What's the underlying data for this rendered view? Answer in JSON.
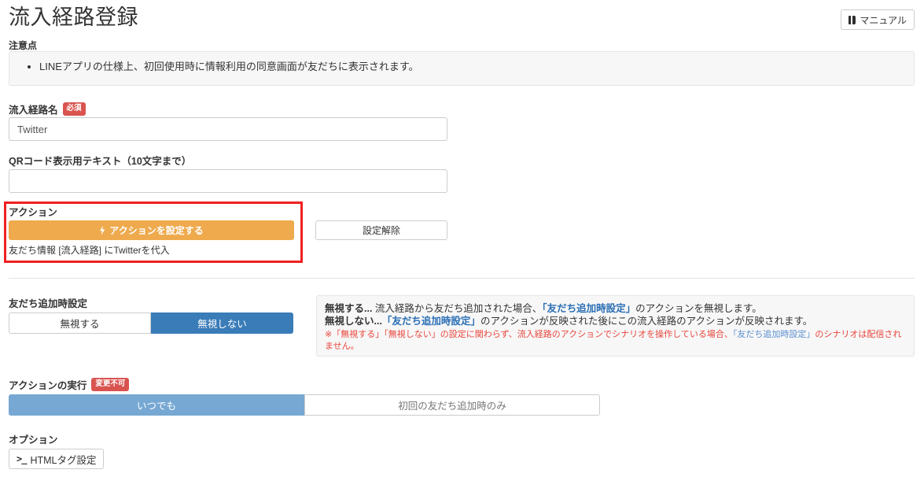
{
  "header": {
    "title": "流入経路登録",
    "manual_button": {
      "label": "マニュアル",
      "icon": "book-icon"
    }
  },
  "notice": {
    "label": "注意点",
    "items": [
      "LINEアプリの仕様上、初回使用時に情報利用の同意画面が友だちに表示されます。"
    ]
  },
  "fields": {
    "route_name": {
      "label": "流入経路名",
      "badge": "必須",
      "value": "Twitter",
      "placeholder": ""
    },
    "qr_text": {
      "label": "QRコード表示用テキスト（10文字まで）",
      "value": "",
      "placeholder": ""
    }
  },
  "action": {
    "label": "アクション",
    "set_button": {
      "label": "アクションを設定する",
      "icon": "bolt-icon",
      "color": "#eeaa4d"
    },
    "description": "友だち情報 [流入経路] にTwitterを代入",
    "clear_button": {
      "label": "設定解除"
    },
    "highlight_color": "#f02020"
  },
  "friend_add_setting": {
    "label": "友だち追加時設定",
    "options": [
      {
        "label": "無視する",
        "selected": false
      },
      {
        "label": "無視しない",
        "selected": true
      }
    ],
    "selected_color": "#3a7cb8",
    "info": {
      "line1_bold": "無視する...",
      "line1_text_a": " 流入経路から友だち追加された場合、",
      "line1_link": "「友だち追加時設定」",
      "line1_text_b": "のアクションを無視します。",
      "line2_bold": "無視しない...",
      "line2_link": "「友だち追加時設定」",
      "line2_text": "のアクションが反映された後にこの流入経路のアクションが反映されます。",
      "warn_a": "※「無視する」「無視しない」の設定に関わらず、流入経路のアクションでシナリオを操作している場合、",
      "warn_link": "「友だち追加時設定」",
      "warn_b": "のシナリオは配信されません。",
      "warn_color": "#e8453c",
      "link_color": "#2b6fb5"
    }
  },
  "action_execution": {
    "label": "アクションの実行",
    "badge": "変更不可",
    "options": [
      {
        "label": "いつでも",
        "selected": true
      },
      {
        "label": "初回の友だち追加時のみ",
        "selected": false
      }
    ],
    "selected_color": "#76a8d3"
  },
  "options_section": {
    "label": "オプション",
    "html_tag_button": {
      "label": "HTMLタグ設定",
      "icon": "terminal-icon"
    }
  }
}
